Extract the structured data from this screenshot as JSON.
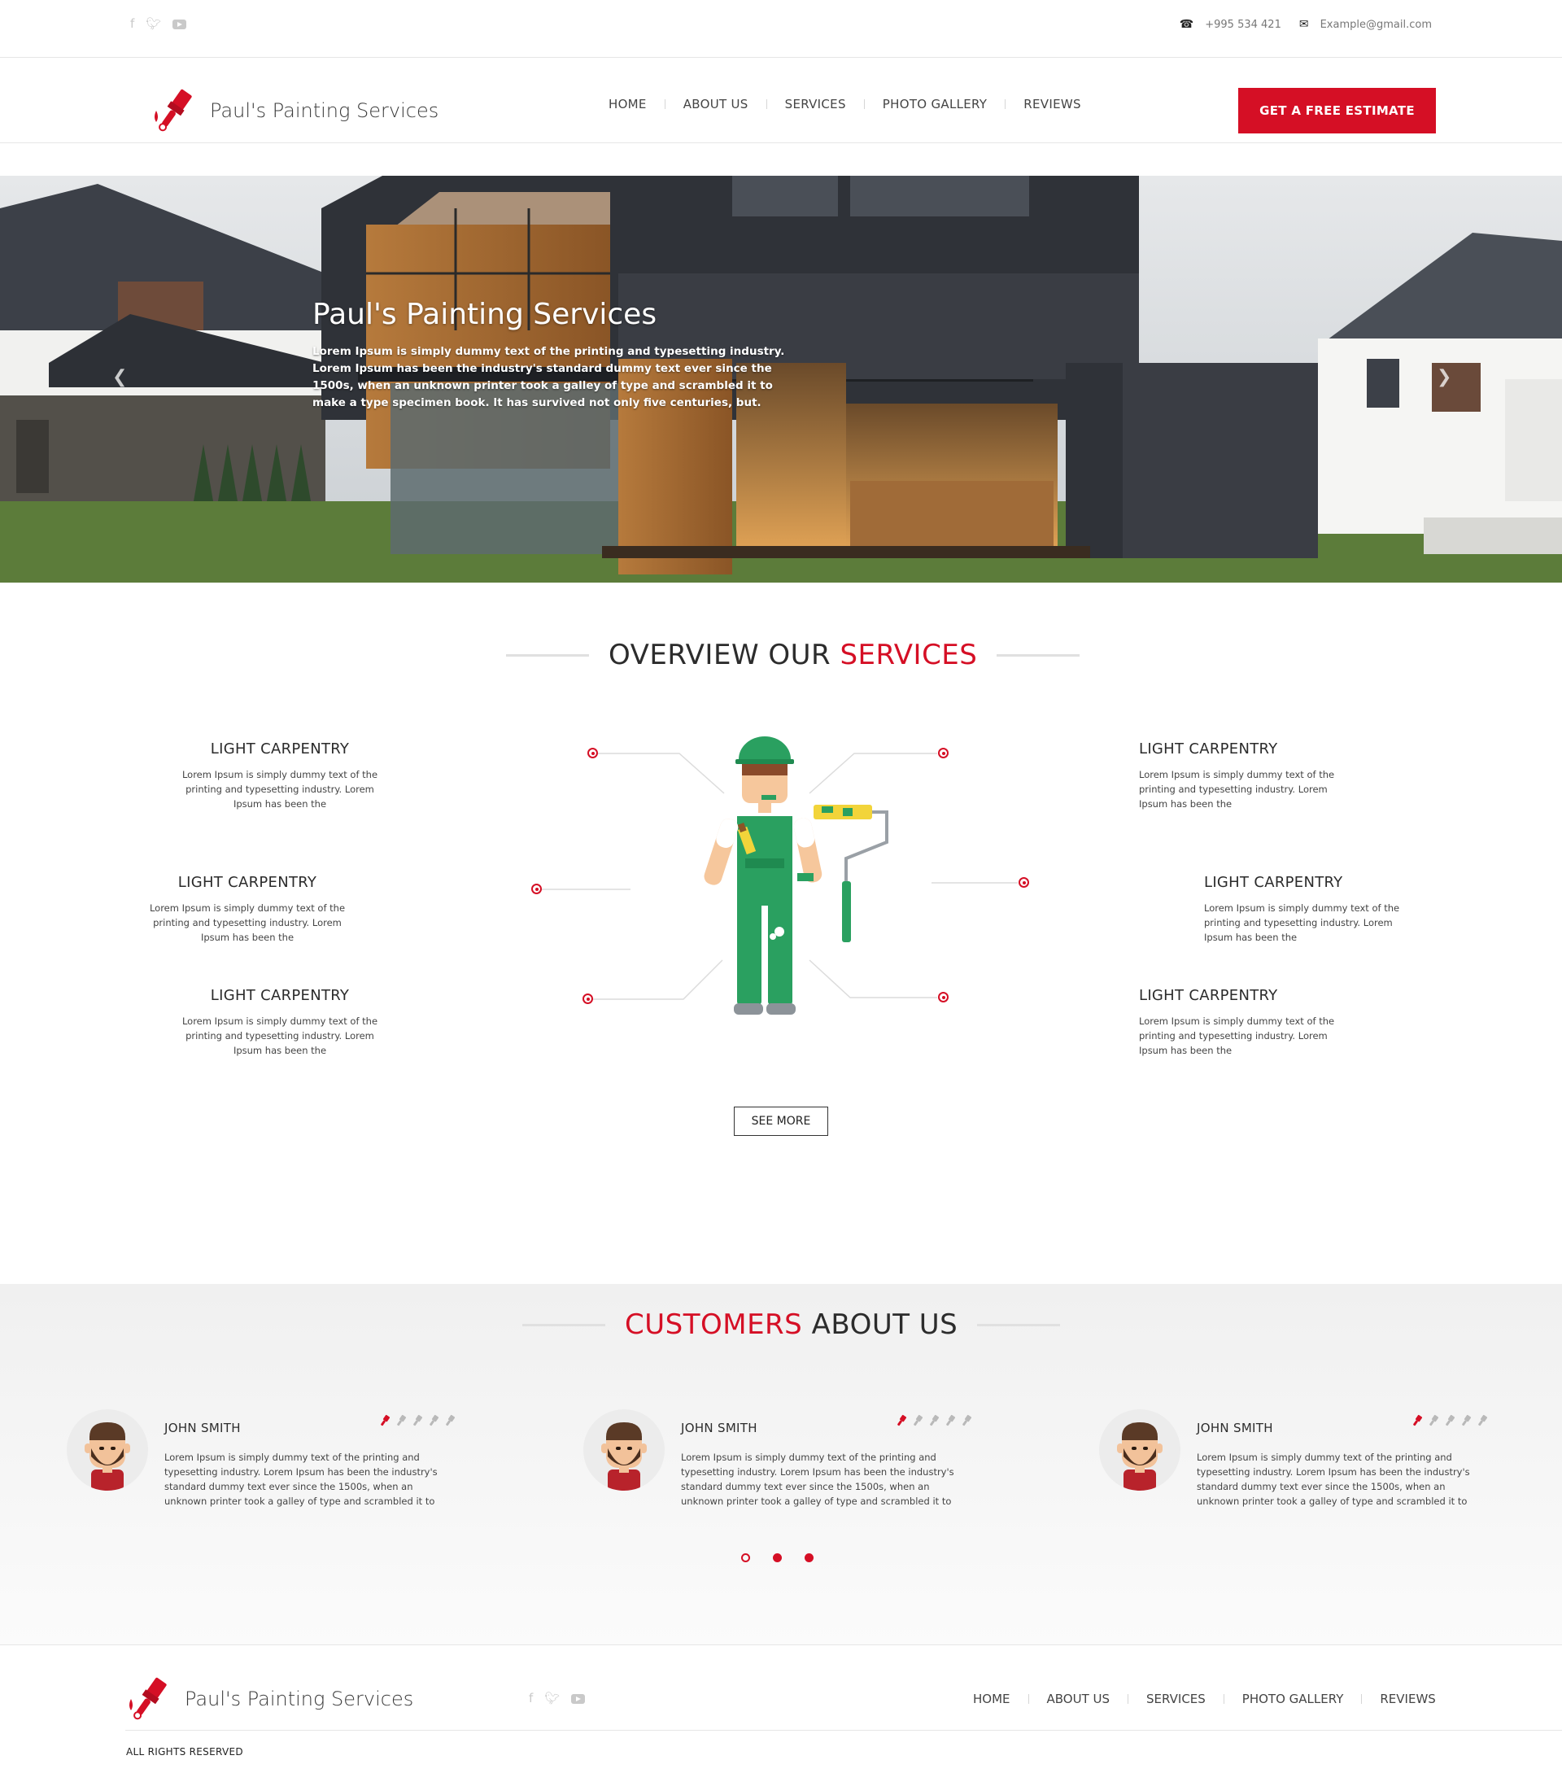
{
  "topbar": {
    "social": [
      "facebook-icon",
      "twitter-icon",
      "youtube-icon"
    ],
    "phone": "+995 534 421",
    "email": "Example@gmail.com"
  },
  "header": {
    "brand": "Paul's Painting Services",
    "nav": [
      "HOME",
      "ABOUT US",
      "SERVICES",
      "PHOTO GALLERY",
      "REVIEWS"
    ],
    "cta": "GET A FREE ESTIMATE"
  },
  "hero": {
    "title": "Paul's Painting Services",
    "text": "Lorem Ipsum is simply dummy text of the printing and typesetting industry. Lorem Ipsum has been the industry's standard dummy text ever since the 1500s, when an unknown printer took a galley of type and scrambled it to make a type specimen book. It has survived not only five centuries, but."
  },
  "services": {
    "title_part1": "OVERVIEW OUR",
    "title_part2": "SERVICES",
    "items": [
      {
        "title": "LIGHT CARPENTRY",
        "text": "Lorem Ipsum is simply dummy text of the printing and typesetting industry. Lorem Ipsum has been the"
      },
      {
        "title": "LIGHT CARPENTRY",
        "text": "Lorem Ipsum is simply dummy text of the printing and typesetting industry. Lorem Ipsum has been the"
      },
      {
        "title": "LIGHT CARPENTRY",
        "text": "Lorem Ipsum is simply dummy text of the printing and typesetting industry. Lorem Ipsum has been the"
      },
      {
        "title": "LIGHT CARPENTRY",
        "text": "Lorem Ipsum is simply dummy text of the printing and typesetting industry. Lorem Ipsum has been the"
      },
      {
        "title": "LIGHT CARPENTRY",
        "text": "Lorem Ipsum is simply dummy text of the printing and typesetting industry. Lorem Ipsum has been the"
      },
      {
        "title": "LIGHT CARPENTRY",
        "text": "Lorem Ipsum is simply dummy text of the printing and typesetting industry. Lorem Ipsum has been the"
      }
    ],
    "see_more": "SEE MORE"
  },
  "customers": {
    "title_part1": "CUSTOMERS",
    "title_part2": "ABOUT US",
    "reviews": [
      {
        "name": "JOHN SMITH",
        "rating": 1,
        "text": "Lorem Ipsum is simply dummy text of the printing and typesetting industry. Lorem Ipsum has been the industry's standard dummy text ever since the 1500s, when an unknown printer took a galley of type and scrambled it to"
      },
      {
        "name": "JOHN SMITH",
        "rating": 1,
        "text": "Lorem Ipsum is simply dummy text of the printing and typesetting industry. Lorem Ipsum has been the industry's standard dummy text ever since the 1500s, when an unknown printer took a galley of type and scrambled it to"
      },
      {
        "name": "JOHN SMITH",
        "rating": 1,
        "text": "Lorem Ipsum is simply dummy text of the printing and typesetting industry. Lorem Ipsum has been the industry's standard dummy text ever since the 1500s, when an unknown printer took a galley of type and scrambled it to"
      }
    ],
    "max_rating": 5,
    "pager_active": [
      false,
      true,
      true
    ]
  },
  "footer": {
    "brand": "Paul's Painting Services",
    "social": [
      "facebook-icon",
      "twitter-icon",
      "youtube-icon"
    ],
    "nav": [
      "HOME",
      "ABOUT US",
      "SERVICES",
      "PHOTO GALLERY",
      "REVIEWS"
    ],
    "copyright": "ALL RIGHTS RESERVED"
  },
  "colors": {
    "accent": "#d50f25",
    "text": "#333333",
    "light_bg": "#f0f0f0"
  }
}
